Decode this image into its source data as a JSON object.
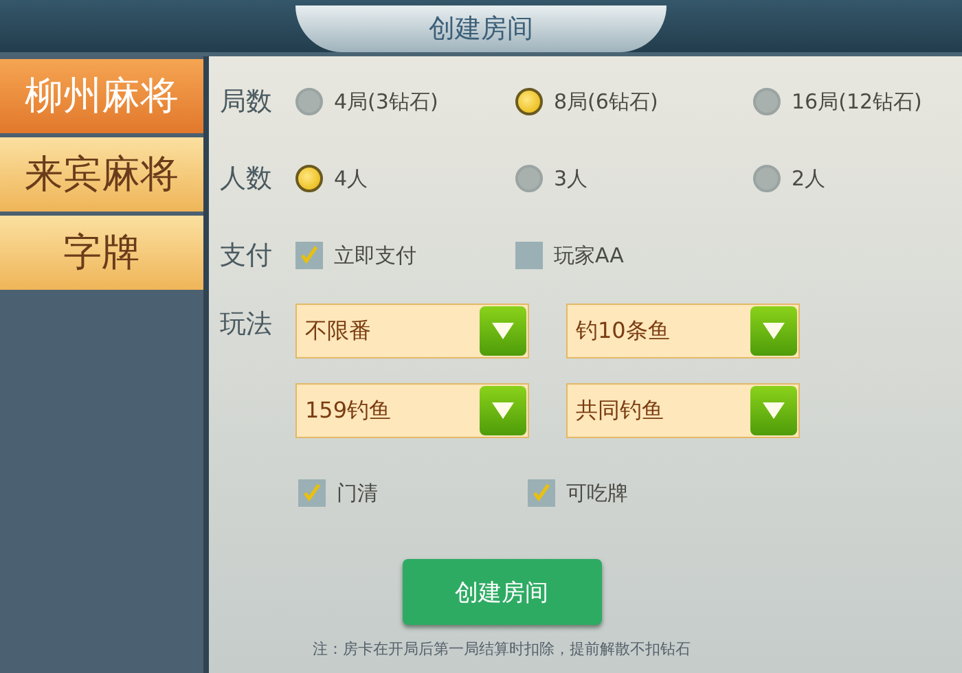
{
  "window": {
    "title": "创建房间"
  },
  "sidebar": {
    "items": [
      {
        "label": "柳州麻将",
        "selected": true
      },
      {
        "label": "来宾麻将",
        "selected": false
      },
      {
        "label": "字牌",
        "selected": false
      }
    ]
  },
  "rounds": {
    "label": "局数",
    "options": [
      {
        "label": "4局(3钻石)",
        "selected": false
      },
      {
        "label": "8局(6钻石)",
        "selected": true
      },
      {
        "label": "16局(12钻石)",
        "selected": false
      }
    ]
  },
  "players": {
    "label": "人数",
    "options": [
      {
        "label": "4人",
        "selected": true
      },
      {
        "label": "3人",
        "selected": false
      },
      {
        "label": "2人",
        "selected": false
      }
    ]
  },
  "payment": {
    "label": "支付",
    "options": [
      {
        "label": "立即支付",
        "checked": true
      },
      {
        "label": "玩家AA",
        "checked": false
      }
    ]
  },
  "rules": {
    "label": "玩法",
    "dropdowns": [
      {
        "value": "不限番"
      },
      {
        "value": "钓10条鱼"
      },
      {
        "value": "159钓鱼"
      },
      {
        "value": "共同钓鱼"
      }
    ],
    "checkboxes": [
      {
        "label": "门清",
        "checked": true
      },
      {
        "label": "可吃牌",
        "checked": true
      }
    ]
  },
  "create_button": "创建房间",
  "note": "注：房卡在开局后第一局结算时扣除，提前解散不扣钻石"
}
